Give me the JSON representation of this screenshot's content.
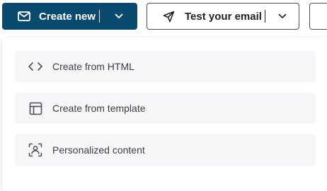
{
  "toolbar": {
    "create_new": {
      "label": "Create new",
      "icon": "envelope-icon",
      "dropdown_icon": "chevron-down-icon",
      "color": "#0b4a6f"
    },
    "test_email": {
      "label": "Test your email",
      "icon": "send-icon",
      "dropdown_icon": "chevron-down-icon"
    }
  },
  "menu": {
    "items": [
      {
        "label": "Create from HTML",
        "icon": "code-icon"
      },
      {
        "label": "Create from template",
        "icon": "layout-template-icon"
      },
      {
        "label": "Personalized content",
        "icon": "personalized-user-icon"
      }
    ]
  }
}
